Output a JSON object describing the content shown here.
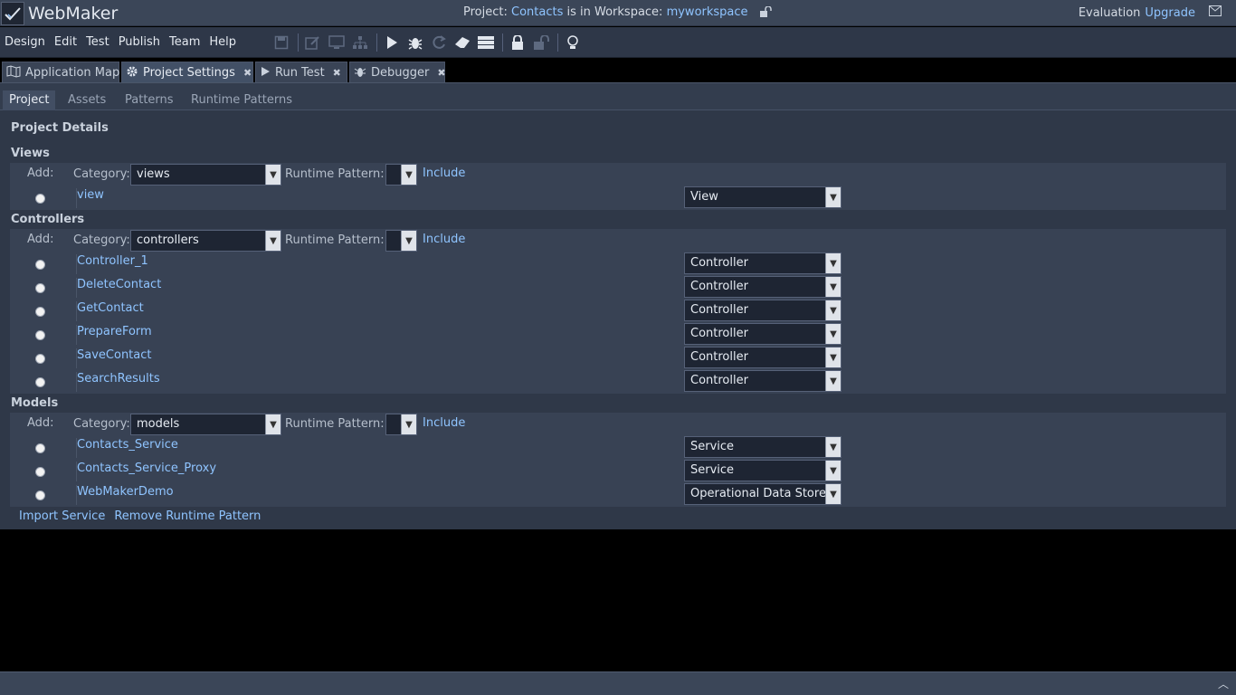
{
  "app": {
    "name": "WebMaker"
  },
  "titlebar": {
    "project_prefix": "Project:",
    "project_name": "Contacts",
    "workspace_text": "is in Workspace:",
    "workspace_name": "myworkspace",
    "evaluation": "Evaluation",
    "upgrade": "Upgrade"
  },
  "menu": [
    "Design",
    "Edit",
    "Test",
    "Publish",
    "Team",
    "Help"
  ],
  "toolbar_icons": [
    "save-icon",
    "edit-icon",
    "monitor-icon",
    "hierarchy-icon",
    "play-icon",
    "bug-icon",
    "refresh-icon",
    "eraser-icon",
    "server-icon",
    "lock-icon",
    "unlock-icon",
    "lightbulb-icon"
  ],
  "tabs": [
    {
      "label": "Application Map",
      "icon": "map-icon",
      "closable": false
    },
    {
      "label": "Project Settings",
      "icon": "gear-icon",
      "closable": true
    },
    {
      "label": "Run Test",
      "icon": "play-icon",
      "closable": true
    },
    {
      "label": "Debugger",
      "icon": "bug-icon",
      "closable": true
    }
  ],
  "subtabs": [
    "Project",
    "Assets",
    "Patterns",
    "Runtime Patterns"
  ],
  "project_details": "Project Details",
  "labels": {
    "add": "Add:",
    "category": "Category:",
    "runtime_pattern": "Runtime Pattern:",
    "include": "Include"
  },
  "sections": [
    {
      "title": "Views",
      "category": "views",
      "items": [
        {
          "name": "view",
          "type": "View"
        }
      ]
    },
    {
      "title": "Controllers",
      "category": "controllers",
      "items": [
        {
          "name": "Controller_1",
          "type": "Controller"
        },
        {
          "name": "DeleteContact",
          "type": "Controller"
        },
        {
          "name": "GetContact",
          "type": "Controller"
        },
        {
          "name": "PrepareForm",
          "type": "Controller"
        },
        {
          "name": "SaveContact",
          "type": "Controller"
        },
        {
          "name": "SearchResults",
          "type": "Controller"
        }
      ]
    },
    {
      "title": "Models",
      "category": "models",
      "items": [
        {
          "name": "Contacts_Service",
          "type": "Service"
        },
        {
          "name": "Contacts_Service_Proxy",
          "type": "Service"
        },
        {
          "name": "WebMakerDemo",
          "type": "Operational Data Store"
        }
      ]
    }
  ],
  "bottom_links": [
    "Import Service",
    "Remove Runtime Pattern"
  ],
  "colors": {
    "link": "#8fc4ff",
    "panel": "#2f3848",
    "titlebar": "#3b4658"
  }
}
